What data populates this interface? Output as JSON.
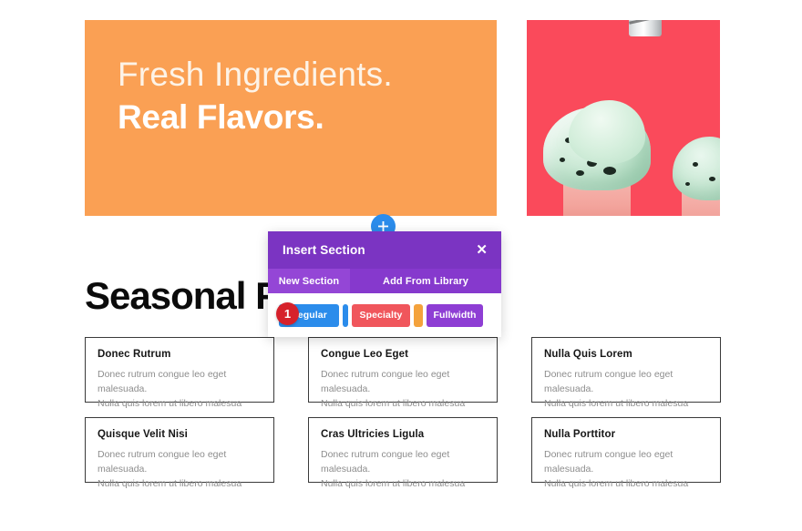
{
  "hero": {
    "line_1": "Fresh Ingredients.",
    "line_2": "Real Flavors.",
    "bg_color": "#faa054"
  },
  "photo": {
    "alt": "mint-chocolate-chip-ice-cream-cones",
    "bg_color": "#fa4a5b"
  },
  "section": {
    "heading": "Seasonal F"
  },
  "cards": [
    {
      "title": "Donec Rutrum",
      "line_1": "Donec rutrum congue leo eget malesuada.",
      "line_2": "Nulla quis lorem ut libero malesua"
    },
    {
      "title": "Congue Leo Eget",
      "line_1": "Donec rutrum congue leo eget malesuada.",
      "line_2": "Nulla quis lorem ut libero malesua"
    },
    {
      "title": "Nulla Quis Lorem",
      "line_1": "Donec rutrum congue leo eget malesuada.",
      "line_2": "Nulla quis lorem ut libero malesua"
    },
    {
      "title": "Quisque Velit Nisi",
      "line_1": "Donec rutrum congue leo eget malesuada.",
      "line_2": "Nulla quis lorem ut libero malesua"
    },
    {
      "title": "Cras Ultricies Ligula",
      "line_1": "Donec rutrum congue leo eget malesuada.",
      "line_2": "Nulla quis lorem ut libero malesua"
    },
    {
      "title": "Nulla Porttitor",
      "line_1": "Donec rutrum congue leo eget malesuada.",
      "line_2": "Nulla quis lorem ut libero malesua"
    }
  ],
  "add_button": {
    "icon": "plus-icon",
    "color": "#2b8ceb"
  },
  "modal": {
    "title": "Insert Section",
    "close_label": "✕",
    "tabs": [
      {
        "label": "New Section",
        "active": true
      },
      {
        "label": "Add From Library",
        "active": false
      }
    ],
    "section_types": [
      {
        "label": "Regular",
        "color": "#2b8ceb"
      },
      {
        "label": "Specialty",
        "color": "#f0565c"
      },
      {
        "label": "Fullwidth",
        "color": "#8e3ed4"
      }
    ],
    "header_color": "#7b34c2",
    "tabbar_color": "#8639cd",
    "active_tab_color": "#9446d6"
  },
  "step_badge": {
    "number": "1",
    "color": "#d6212b"
  }
}
